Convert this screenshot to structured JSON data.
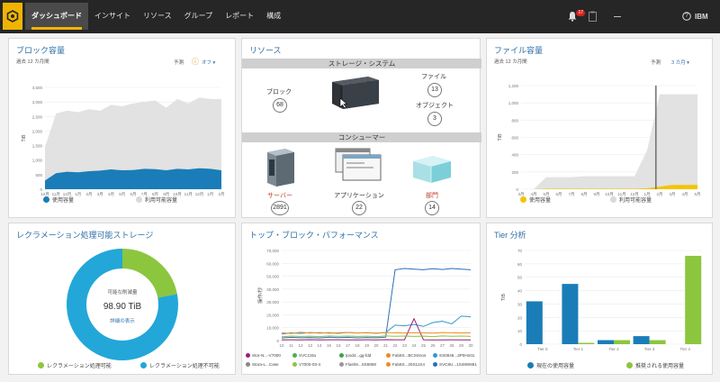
{
  "topbar": {
    "nav": [
      "ダッシュボード",
      "インサイト",
      "リソース",
      "グループ",
      "レポート",
      "構成"
    ],
    "notification_count": "17",
    "help_icon": "?",
    "brand": "IBM"
  },
  "block_capacity": {
    "title": "ブロック容量",
    "period": "過去 12 カ月間",
    "forecast_label": "予測",
    "forecast_value": "オフ ▾",
    "y_unit": "TiB",
    "legend_used": "使用容量",
    "legend_available": "利用可能容量"
  },
  "resources": {
    "title": "リソース",
    "storage_header": "ストレージ・システム",
    "block_label": "ブロック",
    "block_count": "68",
    "file_label": "ファイル",
    "file_count": "13",
    "object_label": "オブジェクト",
    "object_count": "3",
    "consumer_header": "コンシューマー",
    "server_label": "サーバー",
    "server_count": "2891",
    "app_label": "アプリケーション",
    "app_count": "22",
    "dept_label": "部門",
    "dept_count": "14"
  },
  "file_capacity": {
    "title": "ファイル容量",
    "period": "過去 12 カ月間",
    "forecast_label": "予測",
    "forecast_value": "3 カ月 ▾",
    "y_unit": "TiB",
    "legend_used": "使用容量",
    "legend_available": "利用可能容量"
  },
  "reclamation": {
    "title": "レクラメーション処理可能ストレージ",
    "center_label": "可能な削減量",
    "center_value": "98.90 TiB",
    "details_link": "詳細の表示",
    "legend_reclaimable": "レクラメーション処理可能",
    "legend_not_reclaimable": "レクラメーション処理不可能",
    "colors": {
      "reclaimable": "#8cc63f",
      "not_reclaimable": "#22a7d8"
    }
  },
  "top_block": {
    "title": "トップ・ブロック・パフォーマンス",
    "y_unit": "操作/秒",
    "legend": [
      "Stor-N...-V7000",
      "SVC1Sta",
      "Ipod4...gg-fdd",
      "Fab6S...BCSSnos",
      "SS0846...3P0Hn01",
      "Stora-L...Case",
      "V7000-03-4",
      "Flash8...SS5958",
      "Fab6S...20S11S4",
      "SVC8U...1S48W861"
    ],
    "colors": [
      "#9b1c7e",
      "#4caf50",
      "#3fa24a",
      "#ee8c1e",
      "#3399cc",
      "#888888",
      "#8cc63f",
      "#999999",
      "#f08c28",
      "#2a6fba"
    ]
  },
  "tier": {
    "title": "Tier 分析",
    "y_unit": "TiB",
    "legend_current": "現在の使用容量",
    "legend_recommended": "推奨される使用容量"
  },
  "chart_data": [
    {
      "type": "area",
      "title": "ブロック容量",
      "ylabel": "TiB",
      "y_ticks": [
        "3,500",
        "3,000",
        "2,500",
        "2,000",
        "1,500",
        "1,000",
        "500",
        "0"
      ],
      "categories": [
        "10月",
        "11月",
        "12月",
        "1月",
        "2月",
        "3月",
        "4月",
        "5月",
        "6月",
        "7月",
        "8月",
        "9月",
        "10月",
        "11月",
        "12月",
        "1月",
        "2月"
      ],
      "ylim": [
        0,
        3500
      ],
      "series": [
        {
          "name": "利用可能容量",
          "values": [
            1450,
            2600,
            2700,
            2650,
            2750,
            2700,
            2900,
            2850,
            2950,
            3000,
            3050,
            2800,
            3100,
            2950,
            3150,
            3100,
            3100
          ]
        },
        {
          "name": "使用容量",
          "values": [
            300,
            550,
            600,
            580,
            620,
            640,
            680,
            650,
            660,
            700,
            690,
            650,
            700,
            680,
            720,
            700,
            650
          ]
        }
      ]
    },
    {
      "type": "area",
      "title": "ファイル容量",
      "ylabel": "TiB",
      "y_ticks": [
        "1,200",
        "1,000",
        "800",
        "600",
        "400",
        "200",
        "0"
      ],
      "categories": [
        "3月",
        "4月",
        "5月",
        "6月",
        "7月",
        "8月",
        "9月",
        "10月",
        "11月",
        "12月",
        "1月",
        "2月",
        "3月",
        "4月",
        "5月"
      ],
      "ylim": [
        0,
        1200
      ],
      "series": [
        {
          "name": "利用可能容量",
          "values": [
            0,
            0,
            140,
            140,
            140,
            150,
            150,
            150,
            150,
            150,
            450,
            1100,
            1100,
            1100,
            1100
          ]
        },
        {
          "name": "使用容量",
          "values": [
            0,
            0,
            5,
            5,
            5,
            5,
            5,
            5,
            5,
            5,
            10,
            30,
            50,
            50,
            50
          ]
        }
      ]
    },
    {
      "type": "pie",
      "title": "レクラメーション処理可能ストレージ",
      "categories": [
        "レクラメーション処理可能",
        "レクラメーション処理不可能"
      ],
      "values": [
        22,
        78
      ]
    },
    {
      "type": "line",
      "title": "トップ・ブロック・パフォーマンス",
      "ylabel": "操作/秒",
      "y_ticks": [
        "70,000",
        "60,000",
        "50,000",
        "40,000",
        "30,000",
        "20,000",
        "10,000",
        "0"
      ],
      "x": [
        "10",
        "11",
        "12",
        "13",
        "14",
        "15",
        "16",
        "17",
        "18",
        "19",
        "20",
        "21",
        "22",
        "23",
        "24",
        "25",
        "26",
        "27",
        "28",
        "29",
        "30"
      ],
      "ylim": [
        0,
        70000
      ],
      "series": [
        {
          "name": "SVC8U...1S48W861",
          "values": [
            2000,
            2500,
            2200,
            2400,
            2000,
            2600,
            2300,
            2500,
            2100,
            2400,
            2200,
            2600,
            55000,
            56000,
            55500,
            55000,
            55800,
            55200,
            56000,
            55500,
            55000
          ]
        },
        {
          "name": "SS0846...3P0Hn01",
          "values": [
            5000,
            6000,
            5500,
            6200,
            5800,
            6100,
            5600,
            6300,
            5900,
            6000,
            5700,
            6200,
            12000,
            11500,
            12500,
            11000,
            14000,
            15000,
            13000,
            19000,
            18500
          ]
        },
        {
          "name": "Stor-N...-V7000",
          "values": [
            500,
            600,
            550,
            700,
            500,
            650,
            600,
            550,
            500,
            600,
            550,
            700,
            600,
            650,
            17000,
            600,
            550,
            500,
            600,
            550,
            500
          ]
        },
        {
          "name": "Fab6S...BCSSnos",
          "values": [
            6000,
            5500,
            6500,
            5800,
            6200,
            5700,
            6000,
            6300,
            5900,
            6100,
            5800,
            6200,
            6000,
            5900,
            6100,
            6000,
            5800,
            6200,
            6000,
            5900,
            6100
          ]
        },
        {
          "name": "V7000-03-4",
          "values": [
            3000,
            3500,
            3200,
            3400,
            3100,
            3600,
            3300,
            3500,
            3200,
            3400,
            3100,
            3600,
            3300,
            3500,
            3200,
            3400,
            3100,
            3600,
            3300,
            3500,
            3200
          ]
        }
      ]
    },
    {
      "type": "bar",
      "title": "Tier 分析",
      "ylabel": "TiB",
      "y_ticks": [
        "70",
        "60",
        "50",
        "40",
        "30",
        "20",
        "10",
        "0"
      ],
      "categories": [
        "Tier 0",
        "Tier 1",
        "Tier 2",
        "Tier 3",
        "Tier 4"
      ],
      "ylim": [
        0,
        70
      ],
      "series": [
        {
          "name": "現在の使用容量",
          "values": [
            32,
            45,
            3,
            6,
            0
          ]
        },
        {
          "name": "推奨される使用容量",
          "values": [
            0,
            1,
            3,
            3,
            66
          ]
        }
      ]
    }
  ]
}
